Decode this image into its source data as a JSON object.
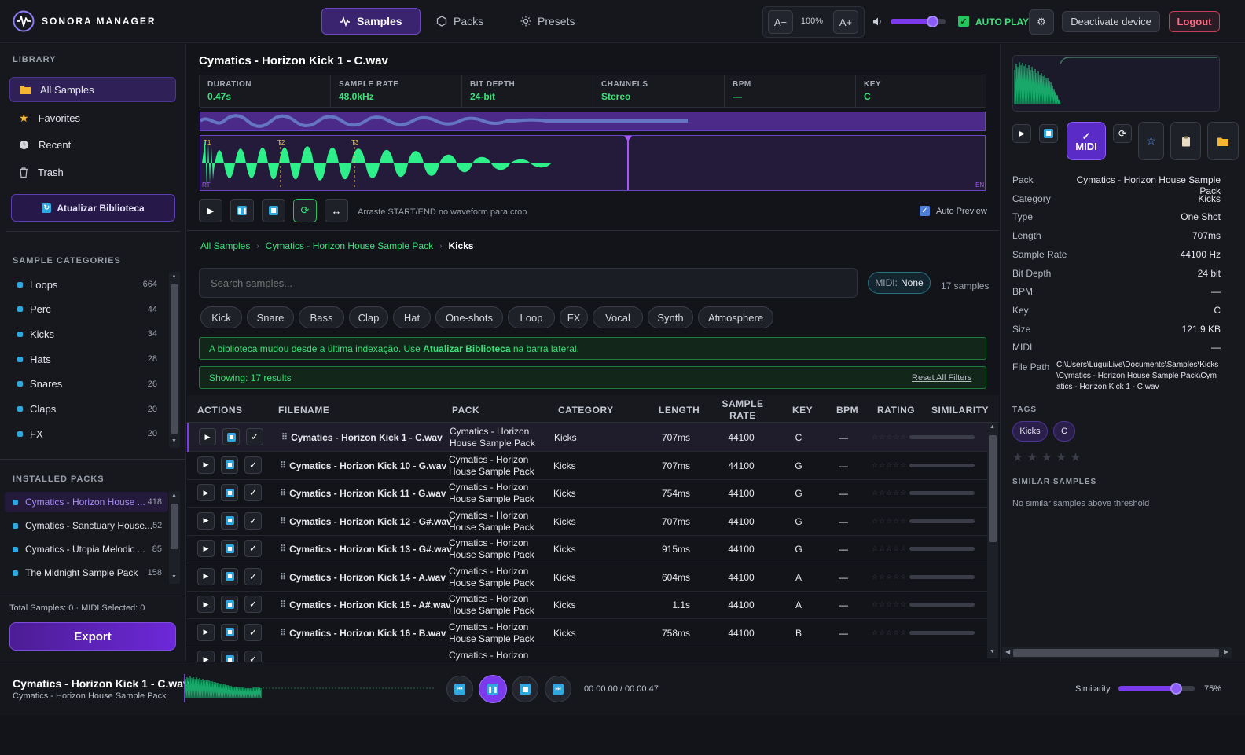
{
  "app": {
    "name": "SONORA MANAGER"
  },
  "nav": {
    "tabs": [
      {
        "label": "Samples"
      },
      {
        "label": "Packs"
      },
      {
        "label": "Presets"
      }
    ]
  },
  "zoom": {
    "decrease": "A−",
    "value": "100%",
    "increase": "A+"
  },
  "volume": {
    "level": 0.75
  },
  "autoplay": {
    "label": "AUTO PLAY",
    "checked": true
  },
  "account": {
    "deactivate": "Deactivate device",
    "logout": "Logout"
  },
  "sidebar": {
    "library_title": "LIBRARY",
    "library_items": [
      {
        "label": "All Samples",
        "icon": "folder-icon"
      },
      {
        "label": "Favorites",
        "icon": "star-icon"
      },
      {
        "label": "Recent",
        "icon": "clock-icon"
      },
      {
        "label": "Trash",
        "icon": "trash-icon"
      }
    ],
    "refresh_label": "Atualizar Biblioteca",
    "categories_title": "SAMPLE CATEGORIES",
    "categories": [
      {
        "label": "Loops",
        "count": "664"
      },
      {
        "label": "Perc",
        "count": "44"
      },
      {
        "label": "Kicks",
        "count": "34"
      },
      {
        "label": "Hats",
        "count": "28"
      },
      {
        "label": "Snares",
        "count": "26"
      },
      {
        "label": "Claps",
        "count": "20"
      },
      {
        "label": "FX",
        "count": "20"
      }
    ],
    "packs_title": "INSTALLED PACKS",
    "packs": [
      {
        "label": "Cymatics - Horizon House ...",
        "count": "418"
      },
      {
        "label": "Cymatics - Sanctuary House...",
        "count": "52"
      },
      {
        "label": "Cymatics - Utopia Melodic ...",
        "count": "85"
      },
      {
        "label": "The Midnight Sample Pack",
        "count": "158"
      }
    ],
    "totals": "Total Samples: 0 · MIDI Selected: 0",
    "export_label": "Export"
  },
  "preview": {
    "title": "Cymatics - Horizon Kick 1 - C.wav",
    "metrics": [
      {
        "label": "DURATION",
        "value": "0.47s"
      },
      {
        "label": "SAMPLE RATE",
        "value": "48.0kHz"
      },
      {
        "label": "BIT DEPTH",
        "value": "24-bit"
      },
      {
        "label": "CHANNELS",
        "value": "Stereo"
      },
      {
        "label": "BPM",
        "value": "—"
      },
      {
        "label": "KEY",
        "value": "C"
      }
    ],
    "markers": [
      "T1",
      "T2",
      "T3"
    ],
    "start_label": "RT",
    "end_label": "EN",
    "crop_hint": "Arraste START/END no waveform para crop",
    "auto_preview_label": "Auto Preview"
  },
  "breadcrumb": [
    "All Samples",
    "Cymatics - Horizon House Sample Pack",
    "Kicks"
  ],
  "search": {
    "placeholder": "Search samples...",
    "midi_label": "MIDI:",
    "midi_value": "None",
    "count": "17 samples"
  },
  "filters": [
    "Kick",
    "Snare",
    "Bass",
    "Clap",
    "Hat",
    "One-shots",
    "Loop",
    "FX",
    "Vocal",
    "Synth",
    "Atmosphere"
  ],
  "notice": {
    "before": "A biblioteca mudou desde a última indexação. Use ",
    "link": "Atualizar Biblioteca",
    "after": " na barra lateral."
  },
  "results": {
    "showing": "Showing: 17 results",
    "reset": "Reset All Filters"
  },
  "table": {
    "headers": [
      "ACTIONS",
      "FILENAME",
      "PACK",
      "CATEGORY",
      "LENGTH",
      "SAMPLE RATE",
      "KEY",
      "BPM",
      "RATING",
      "SIMILARITY"
    ],
    "rows": [
      {
        "file": "Cymatics - Horizon Kick 1 - C.wav",
        "pack": "Cymatics - Horizon House Sample Pack",
        "category": "Kicks",
        "length": "707ms",
        "rate": "44100",
        "key": "C",
        "bpm": "—",
        "rating": "☆☆☆☆☆"
      },
      {
        "file": "Cymatics - Horizon Kick 10 - G.wav",
        "pack": "Cymatics - Horizon House Sample Pack",
        "category": "Kicks",
        "length": "707ms",
        "rate": "44100",
        "key": "G",
        "bpm": "—",
        "rating": "☆☆☆☆☆"
      },
      {
        "file": "Cymatics - Horizon Kick 11 - G.wav",
        "pack": "Cymatics - Horizon House Sample Pack",
        "category": "Kicks",
        "length": "754ms",
        "rate": "44100",
        "key": "G",
        "bpm": "—",
        "rating": "☆☆☆☆☆"
      },
      {
        "file": "Cymatics - Horizon Kick 12 - G#.wav",
        "pack": "Cymatics - Horizon House Sample Pack",
        "category": "Kicks",
        "length": "707ms",
        "rate": "44100",
        "key": "G",
        "bpm": "—",
        "rating": "☆☆☆☆☆"
      },
      {
        "file": "Cymatics - Horizon Kick 13 - G#.wav",
        "pack": "Cymatics - Horizon House Sample Pack",
        "category": "Kicks",
        "length": "915ms",
        "rate": "44100",
        "key": "G",
        "bpm": "—",
        "rating": "☆☆☆☆☆"
      },
      {
        "file": "Cymatics - Horizon Kick 14 - A.wav",
        "pack": "Cymatics - Horizon House Sample Pack",
        "category": "Kicks",
        "length": "604ms",
        "rate": "44100",
        "key": "A",
        "bpm": "—",
        "rating": "☆☆☆☆☆"
      },
      {
        "file": "Cymatics - Horizon Kick 15 - A#.wav",
        "pack": "Cymatics - Horizon House Sample Pack",
        "category": "Kicks",
        "length": "1.1s",
        "rate": "44100",
        "key": "A",
        "bpm": "—",
        "rating": "☆☆☆☆☆"
      },
      {
        "file": "Cymatics - Horizon Kick 16 - B.wav",
        "pack": "Cymatics - Horizon House Sample Pack",
        "category": "Kicks",
        "length": "758ms",
        "rate": "44100",
        "key": "B",
        "bpm": "—",
        "rating": "☆☆☆☆☆"
      }
    ],
    "partial_row": {
      "pack": "Cymatics - Horizon"
    }
  },
  "details": {
    "midi_label": "MIDI",
    "fields": [
      {
        "label": "Pack",
        "value": "Cymatics - Horizon House Sample Pack"
      },
      {
        "label": "Category",
        "value": "Kicks"
      },
      {
        "label": "Type",
        "value": "One Shot"
      },
      {
        "label": "Length",
        "value": "707ms"
      },
      {
        "label": "Sample Rate",
        "value": "44100 Hz"
      },
      {
        "label": "Bit Depth",
        "value": "24 bit"
      },
      {
        "label": "BPM",
        "value": "—"
      },
      {
        "label": "Key",
        "value": "C"
      },
      {
        "label": "Size",
        "value": "121.9 KB"
      },
      {
        "label": "MIDI",
        "value": "—"
      }
    ],
    "file_path_label": "File Path",
    "file_path": "C:\\Users\\LuguiLive\\Documents\\Samples\\Kicks\\Cymatics - Horizon House Sample Pack\\Cymatics - Horizon Kick 1 - C.wav",
    "tags_title": "TAGS",
    "tags": [
      "Kicks",
      "C"
    ],
    "rating": "★★★★★",
    "similar_title": "SIMILAR SAMPLES",
    "similar_empty": "No similar samples above threshold"
  },
  "player": {
    "title": "Cymatics - Horizon Kick 1 - C.wav",
    "subtitle": "Cymatics - Horizon House Sample Pack",
    "time": "00:00.00 / 00:00.47",
    "similarity_label": "Similarity",
    "similarity_value": "75%",
    "similarity_level": 0.75
  },
  "colors": {
    "accent": "#7c3aed",
    "green": "#3de07a",
    "cyan": "#2fa8e0",
    "danger": "#ff6b86"
  }
}
